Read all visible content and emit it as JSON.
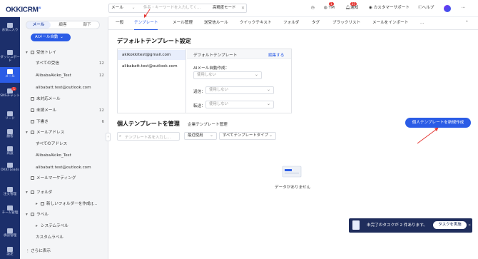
{
  "app": {
    "brand": "OKKICRM",
    "brand_sup": "AI"
  },
  "rail": [
    {
      "label": "お気に入り",
      "icon": "star-icon"
    },
    {
      "label": "ダッシュボード",
      "icon": "dashboard-icon"
    },
    {
      "label": "メール",
      "icon": "mail-icon",
      "active": true
    },
    {
      "label": "SNSチャット",
      "icon": "chat-icon",
      "badge": "1"
    },
    {
      "label": "リード",
      "icon": "lead-icon"
    },
    {
      "label": "顧客",
      "icon": "customer-icon"
    },
    {
      "label": "商談",
      "icon": "deal-icon"
    },
    {
      "label": "OKKI Leads",
      "icon": "leads-icon"
    },
    {
      "label": "注文管理",
      "icon": "order-icon"
    },
    {
      "label": "チーム管理",
      "icon": "team-icon"
    },
    {
      "label": "承認管理",
      "icon": "approval-icon"
    },
    {
      "label": "設定",
      "icon": "settings-icon"
    }
  ],
  "sidebar": {
    "segments": [
      "メール",
      "顧客",
      "部下"
    ],
    "ai_button": "AIメール自動",
    "inbox": "受信トレイ",
    "all_received": "すべての受信",
    "all_received_count": "12",
    "acct1": "AlibabaAkiko_Test",
    "acct1_count": "12",
    "acct2": "alibabatt.test@outlook.com",
    "unread": "未対応メール",
    "unsent": "未読メール",
    "unsent_count": "12",
    "drafts": "下書き",
    "drafts_count": "6",
    "addresses": "メールアドレス",
    "all_addresses": "すべてのアドレス",
    "addr1": "AlibabaAkiko_Test",
    "addr2": "alibabatt.test@outlook.com",
    "marketing": "メールマーケティング",
    "folders": "フォルダ",
    "new_folder": "新しいフォルダーを作成([...",
    "labels": "ラベル",
    "system_labels": "システムラベル",
    "custom_labels": "カスタムラベル",
    "more": "さらに表示"
  },
  "topbar": {
    "search_type": "メール",
    "search_placeholder": "件名・キーワードを入力してく...",
    "advanced": "高精度モード",
    "tm": "TM",
    "tm_badge": "1",
    "notice": "通知",
    "notice_badge": "27",
    "support": "カスタマーサポート",
    "help": "ヘルプ"
  },
  "tabs": [
    "一般",
    "テンプレート",
    "メール管理",
    "送受信ルール",
    "クイックテキスト",
    "フォルダ",
    "タグ",
    "ブラックリスト",
    "メールをインポート",
    "…"
  ],
  "default_section": {
    "title": "デフォルトテンプレート設定",
    "accounts": [
      "akikokkitest@gmail.com",
      "alibabatt.test@outlook.com"
    ],
    "header_label": "デフォルトテンプレート",
    "edit": "編集する",
    "ai_label": "AIメール自動作成：",
    "ai_value": "使用しない",
    "reply_label": "返信：",
    "reply_value": "使用しない",
    "forward_label": "転送：",
    "forward_value": "使用しない"
  },
  "personal_section": {
    "title": "個人テンプレートを管理",
    "link": "企業テンプレート管理",
    "new_button": "個人テンプレートを新規作成",
    "search_placeholder": "テンプレート名を入力し...",
    "sort": "最近使用",
    "type": "すべてテンプレートタイプ",
    "empty": "データがありません"
  },
  "toast": {
    "text": "未完了のタスクが 2 件あります。",
    "button": "タスクを実施"
  },
  "colors": {
    "accent": "#2b5ce6",
    "rail": "#1c2f6b",
    "toast": "#1f2d5c",
    "arrow": "#e53935"
  }
}
